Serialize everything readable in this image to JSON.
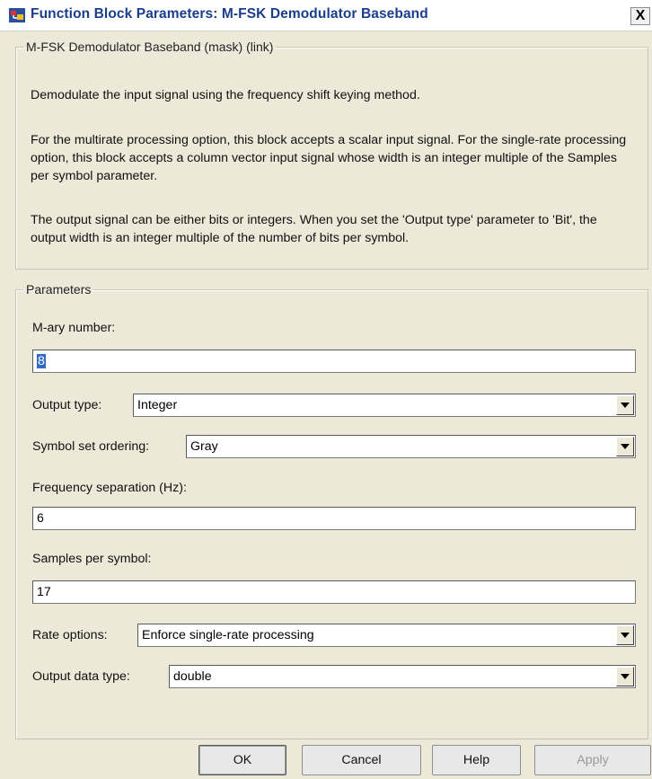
{
  "window": {
    "title": "Function Block Parameters: M-FSK Demodulator Baseband",
    "close_glyph": "X"
  },
  "description": {
    "legend": "M-FSK Demodulator Baseband (mask) (link)",
    "para1": "Demodulate the input signal using the frequency shift keying method.",
    "para2": "For the multirate processing option, this block accepts a scalar input signal.  For the single-rate processing option, this block accepts a column vector input signal whose width is an integer multiple of the Samples per symbol parameter.",
    "para3": "The output signal can be either bits or integers.  When you set the 'Output type' parameter to 'Bit', the output width is an integer multiple of the number of bits per symbol."
  },
  "parameters": {
    "legend": "Parameters",
    "m_ary_label": "M-ary number:",
    "m_ary_value": "8",
    "output_type_label": "Output type:",
    "output_type_value": "Integer",
    "symbol_order_label": "Symbol set ordering:",
    "symbol_order_value": "Gray",
    "freq_sep_label": "Frequency separation (Hz):",
    "freq_sep_value": "6",
    "samples_label": "Samples per symbol:",
    "samples_value": "17",
    "rate_label": "Rate options:",
    "rate_value": "Enforce single-rate processing",
    "data_type_label": "Output data type:",
    "data_type_value": "double"
  },
  "buttons": {
    "ok": "OK",
    "cancel": "Cancel",
    "help": "Help",
    "apply": "Apply"
  },
  "icons": {
    "app": "simulink-block-icon",
    "close": "close-icon",
    "dropdown": "chevron-down-icon"
  }
}
